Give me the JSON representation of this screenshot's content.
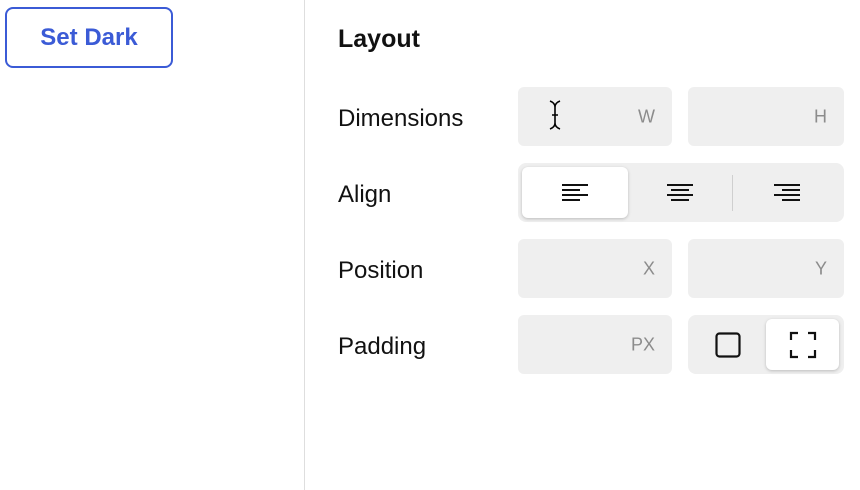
{
  "toolbar": {
    "set_dark_label": "Set Dark"
  },
  "panel": {
    "title": "Layout",
    "rows": {
      "dimensions": {
        "label": "Dimensions",
        "width_suffix": "W",
        "height_suffix": "H"
      },
      "align": {
        "label": "Align",
        "options": [
          "align-left",
          "align-center",
          "align-right"
        ],
        "selected": "align-left"
      },
      "position": {
        "label": "Position",
        "x_suffix": "X",
        "y_suffix": "Y"
      },
      "padding": {
        "label": "Padding",
        "unit_suffix": "PX",
        "modes": [
          "uniform",
          "individual"
        ],
        "selected": "individual"
      }
    }
  },
  "colors": {
    "accent": "#3b5bd6",
    "field_bg": "#efefef",
    "suffix_text": "#8c8c8c",
    "divider": "#dedede"
  }
}
